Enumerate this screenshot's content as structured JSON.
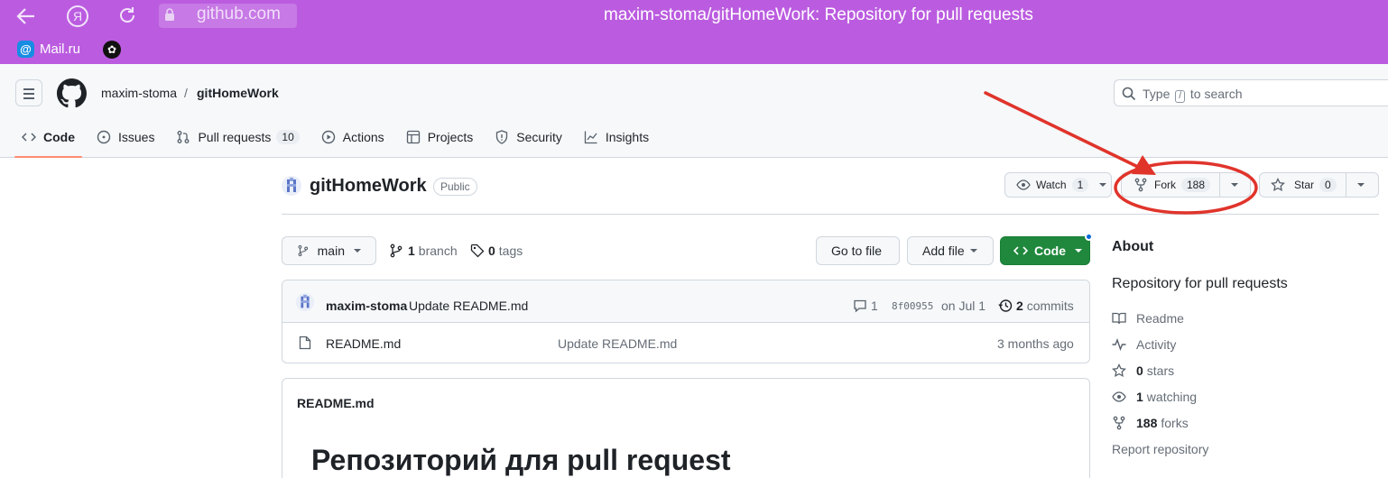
{
  "browser": {
    "yandex_glyph": "Я",
    "url": "github.com",
    "tab_title": "maxim-stoma/gitHomeWork: Repository for pull requests",
    "bookmarks": [
      {
        "label": "Mail.ru"
      }
    ]
  },
  "header": {
    "owner": "maxim-stoma",
    "separator": "/",
    "repo": "gitHomeWork",
    "search_prefix": "Type",
    "search_key": "/",
    "search_suffix": "to search"
  },
  "tabs": [
    {
      "label": "Code",
      "active": true
    },
    {
      "label": "Issues"
    },
    {
      "label": "Pull requests",
      "count": "10"
    },
    {
      "label": "Actions"
    },
    {
      "label": "Projects"
    },
    {
      "label": "Security"
    },
    {
      "label": "Insights"
    }
  ],
  "repo": {
    "name": "gitHomeWork",
    "visibility": "Public",
    "watch_label": "Watch",
    "watch_count": "1",
    "fork_label": "Fork",
    "fork_count": "188",
    "star_label": "Star",
    "star_count": "0"
  },
  "filenav": {
    "branch": "main",
    "branches_count": "1",
    "branches_label": "branch",
    "tags_count": "0",
    "tags_label": "tags",
    "go_to_file": "Go to file",
    "add_file": "Add file",
    "code": "Code"
  },
  "commit": {
    "author": "maxim-stoma",
    "message": "Update README.md",
    "comments": "1",
    "sha": "8f00955",
    "date": "on Jul 1",
    "commits_count": "2",
    "commits_label": "commits"
  },
  "files": [
    {
      "name": "README.md",
      "message": "Update README.md",
      "age": "3 months ago"
    }
  ],
  "readme": {
    "filename": "README.md",
    "heading": "Репозиторий для pull request"
  },
  "about": {
    "title": "About",
    "description": "Repository for pull requests",
    "readme": "Readme",
    "activity": "Activity",
    "stars_count": "0",
    "stars_label": "stars",
    "watching_count": "1",
    "watching_label": "watching",
    "forks_count": "188",
    "forks_label": "forks",
    "report": "Report repository"
  },
  "colors": {
    "browser_bar": "#bb5ce0",
    "annotation": "#e0342b",
    "primary_button": "#1f883d",
    "tab_underline": "#fd8c73"
  }
}
